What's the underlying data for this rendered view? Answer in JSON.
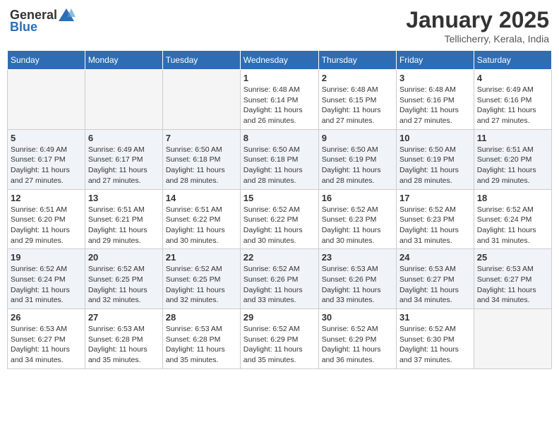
{
  "logo": {
    "text_general": "General",
    "text_blue": "Blue"
  },
  "title": "January 2025",
  "location": "Tellicherry, Kerala, India",
  "days_of_week": [
    "Sunday",
    "Monday",
    "Tuesday",
    "Wednesday",
    "Thursday",
    "Friday",
    "Saturday"
  ],
  "weeks": [
    [
      {
        "day": "",
        "info": ""
      },
      {
        "day": "",
        "info": ""
      },
      {
        "day": "",
        "info": ""
      },
      {
        "day": "1",
        "info": "Sunrise: 6:48 AM\nSunset: 6:14 PM\nDaylight: 11 hours\nand 26 minutes."
      },
      {
        "day": "2",
        "info": "Sunrise: 6:48 AM\nSunset: 6:15 PM\nDaylight: 11 hours\nand 27 minutes."
      },
      {
        "day": "3",
        "info": "Sunrise: 6:48 AM\nSunset: 6:16 PM\nDaylight: 11 hours\nand 27 minutes."
      },
      {
        "day": "4",
        "info": "Sunrise: 6:49 AM\nSunset: 6:16 PM\nDaylight: 11 hours\nand 27 minutes."
      }
    ],
    [
      {
        "day": "5",
        "info": "Sunrise: 6:49 AM\nSunset: 6:17 PM\nDaylight: 11 hours\nand 27 minutes."
      },
      {
        "day": "6",
        "info": "Sunrise: 6:49 AM\nSunset: 6:17 PM\nDaylight: 11 hours\nand 27 minutes."
      },
      {
        "day": "7",
        "info": "Sunrise: 6:50 AM\nSunset: 6:18 PM\nDaylight: 11 hours\nand 28 minutes."
      },
      {
        "day": "8",
        "info": "Sunrise: 6:50 AM\nSunset: 6:18 PM\nDaylight: 11 hours\nand 28 minutes."
      },
      {
        "day": "9",
        "info": "Sunrise: 6:50 AM\nSunset: 6:19 PM\nDaylight: 11 hours\nand 28 minutes."
      },
      {
        "day": "10",
        "info": "Sunrise: 6:50 AM\nSunset: 6:19 PM\nDaylight: 11 hours\nand 28 minutes."
      },
      {
        "day": "11",
        "info": "Sunrise: 6:51 AM\nSunset: 6:20 PM\nDaylight: 11 hours\nand 29 minutes."
      }
    ],
    [
      {
        "day": "12",
        "info": "Sunrise: 6:51 AM\nSunset: 6:20 PM\nDaylight: 11 hours\nand 29 minutes."
      },
      {
        "day": "13",
        "info": "Sunrise: 6:51 AM\nSunset: 6:21 PM\nDaylight: 11 hours\nand 29 minutes."
      },
      {
        "day": "14",
        "info": "Sunrise: 6:51 AM\nSunset: 6:22 PM\nDaylight: 11 hours\nand 30 minutes."
      },
      {
        "day": "15",
        "info": "Sunrise: 6:52 AM\nSunset: 6:22 PM\nDaylight: 11 hours\nand 30 minutes."
      },
      {
        "day": "16",
        "info": "Sunrise: 6:52 AM\nSunset: 6:23 PM\nDaylight: 11 hours\nand 30 minutes."
      },
      {
        "day": "17",
        "info": "Sunrise: 6:52 AM\nSunset: 6:23 PM\nDaylight: 11 hours\nand 31 minutes."
      },
      {
        "day": "18",
        "info": "Sunrise: 6:52 AM\nSunset: 6:24 PM\nDaylight: 11 hours\nand 31 minutes."
      }
    ],
    [
      {
        "day": "19",
        "info": "Sunrise: 6:52 AM\nSunset: 6:24 PM\nDaylight: 11 hours\nand 31 minutes."
      },
      {
        "day": "20",
        "info": "Sunrise: 6:52 AM\nSunset: 6:25 PM\nDaylight: 11 hours\nand 32 minutes."
      },
      {
        "day": "21",
        "info": "Sunrise: 6:52 AM\nSunset: 6:25 PM\nDaylight: 11 hours\nand 32 minutes."
      },
      {
        "day": "22",
        "info": "Sunrise: 6:52 AM\nSunset: 6:26 PM\nDaylight: 11 hours\nand 33 minutes."
      },
      {
        "day": "23",
        "info": "Sunrise: 6:53 AM\nSunset: 6:26 PM\nDaylight: 11 hours\nand 33 minutes."
      },
      {
        "day": "24",
        "info": "Sunrise: 6:53 AM\nSunset: 6:27 PM\nDaylight: 11 hours\nand 34 minutes."
      },
      {
        "day": "25",
        "info": "Sunrise: 6:53 AM\nSunset: 6:27 PM\nDaylight: 11 hours\nand 34 minutes."
      }
    ],
    [
      {
        "day": "26",
        "info": "Sunrise: 6:53 AM\nSunset: 6:27 PM\nDaylight: 11 hours\nand 34 minutes."
      },
      {
        "day": "27",
        "info": "Sunrise: 6:53 AM\nSunset: 6:28 PM\nDaylight: 11 hours\nand 35 minutes."
      },
      {
        "day": "28",
        "info": "Sunrise: 6:53 AM\nSunset: 6:28 PM\nDaylight: 11 hours\nand 35 minutes."
      },
      {
        "day": "29",
        "info": "Sunrise: 6:52 AM\nSunset: 6:29 PM\nDaylight: 11 hours\nand 35 minutes."
      },
      {
        "day": "30",
        "info": "Sunrise: 6:52 AM\nSunset: 6:29 PM\nDaylight: 11 hours\nand 36 minutes."
      },
      {
        "day": "31",
        "info": "Sunrise: 6:52 AM\nSunset: 6:30 PM\nDaylight: 11 hours\nand 37 minutes."
      },
      {
        "day": "",
        "info": ""
      }
    ]
  ]
}
